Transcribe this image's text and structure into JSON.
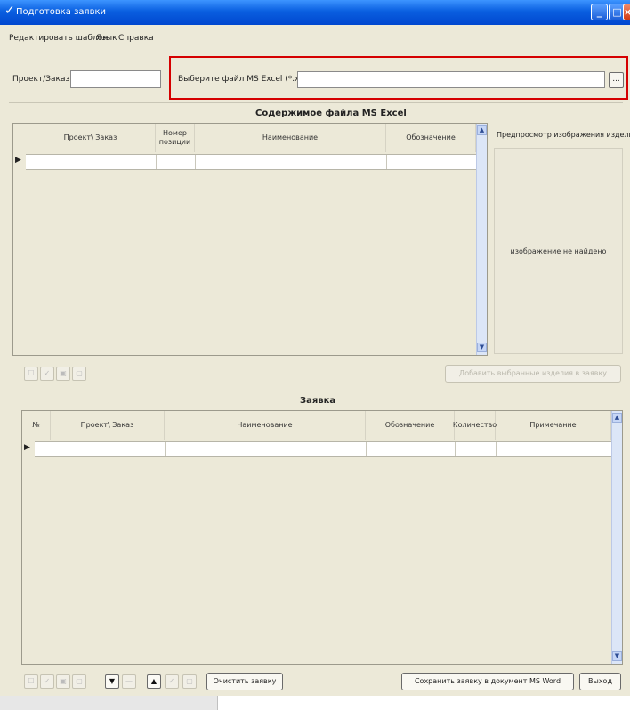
{
  "window": {
    "title": "Подготовка заявки",
    "controls": {
      "minimize": "_",
      "maximize": "□",
      "close": "×"
    }
  },
  "menu": {
    "items": [
      "Редактировать шаблон",
      "Язык",
      "Справка"
    ]
  },
  "form": {
    "project_label": "Проект/Заказ:",
    "project_value": "",
    "file_label": "Выберите файл MS Excel (*.xls):",
    "file_value": "",
    "browse_label": "..."
  },
  "excel_section": {
    "title": "Содержимое файла MS Excel",
    "columns": [
      "Проект\\ Заказ",
      "Номер позиции",
      "Наименование",
      "Обозначение"
    ],
    "preview_title": "Предпросмотр изображения изделия",
    "preview_text": "изображение не найдено"
  },
  "excel_toolbar": {
    "add_selected_label": "Добавить выбранные изделия в заявку"
  },
  "request_section": {
    "title": "Заявка",
    "columns": [
      "№",
      "Проект\\ Заказ",
      "Наименование",
      "Обозначение",
      "Количество",
      "Примечание"
    ]
  },
  "bottom_toolbar": {
    "clear_label": "Очистить заявку",
    "save_label": "Сохранить заявку в документ MS Word",
    "exit_label": "Выход"
  },
  "colors": {
    "title_bar": "#0a5fe0",
    "highlight_border": "#d50000",
    "window_background": "#ece9d8"
  }
}
